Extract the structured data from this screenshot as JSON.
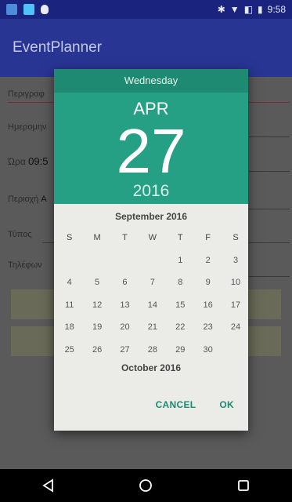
{
  "status_bar": {
    "time": "9:58",
    "icons": [
      "document-icon",
      "image-icon",
      "android-debug-icon",
      "bluetooth-icon",
      "wifi-icon",
      "no-sim-icon",
      "battery-icon"
    ]
  },
  "app": {
    "title": "EventPlanner"
  },
  "form": {
    "description_label": "Περιγραφ",
    "date_label": "Ημερομην",
    "time_label": "Ώρα",
    "time_value": "09:5",
    "area_label": "Περιοχή",
    "area_value": "A",
    "type_label": "Τύπος",
    "phone_label": "Τηλέφων"
  },
  "dialog": {
    "weekday": "Wednesday",
    "month": "APR",
    "day": "27",
    "year": "2016",
    "calendar_title": "September 2016",
    "weekday_headers": [
      "S",
      "M",
      "T",
      "W",
      "T",
      "F",
      "S"
    ],
    "weeks": [
      [
        "",
        "",
        "",
        "",
        "1",
        "2",
        "3"
      ],
      [
        "4",
        "5",
        "6",
        "7",
        "8",
        "9",
        "10"
      ],
      [
        "11",
        "12",
        "13",
        "14",
        "15",
        "16",
        "17"
      ],
      [
        "18",
        "19",
        "20",
        "21",
        "22",
        "23",
        "24"
      ],
      [
        "25",
        "26",
        "27",
        "28",
        "29",
        "30",
        ""
      ]
    ],
    "next_month_title": "October 2016",
    "cancel_label": "CANCEL",
    "ok_label": "OK"
  },
  "colors": {
    "header": "#26a085",
    "header_weekday": "#1e8a72",
    "accent": "#1e8a72",
    "app_bar": "#283593"
  }
}
